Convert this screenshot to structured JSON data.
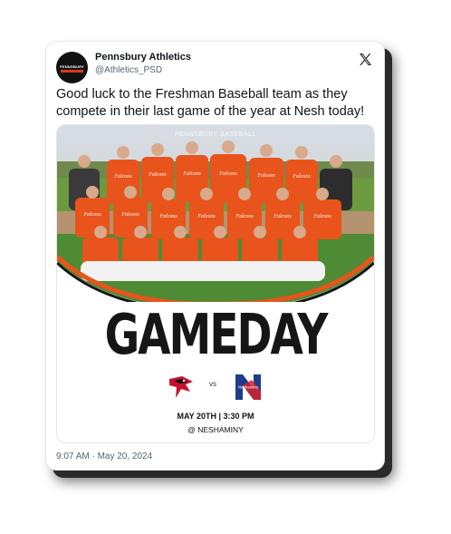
{
  "author": {
    "name": "Pennsbury Athletics",
    "handle": "@Athletics_PSD",
    "avatar_text": "PENNSBURY"
  },
  "tweet": {
    "text": "Good luck to the Freshman Baseball team as they compete in their last game of the year at Nesh today!",
    "timestamp": "9:07 AM · May 20, 2024"
  },
  "media": {
    "watermark": "PENNSBURY BASEBALL",
    "headline": "GAMEDAY",
    "vs_label": "vs",
    "away_logo_text": "Neshaminy",
    "date_time": "MAY 20TH | 3:30 PM",
    "venue": "@ NESHAMINY",
    "jersey_text": "Falcons"
  },
  "colors": {
    "accent_orange": "#e8541b",
    "text_primary": "#0f1419",
    "text_secondary": "#536471"
  },
  "icons": {
    "platform": "x-logo-icon",
    "home_team": "falcon-logo-icon",
    "away_team": "neshaminy-logo-icon"
  }
}
